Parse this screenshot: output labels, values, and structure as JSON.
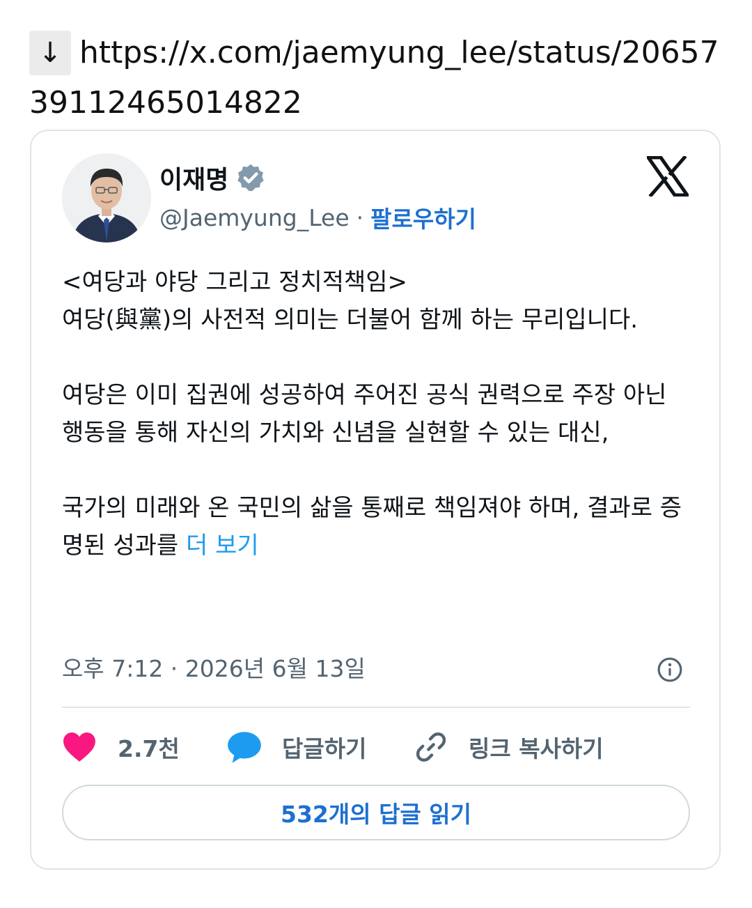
{
  "shared": {
    "arrow": "↓",
    "url": "https://x.com/jaemyung_lee/status/2065739112465014822"
  },
  "author": {
    "display_name": "이재명",
    "handle": "@Jaemyung_Lee",
    "separator": "·",
    "follow_label": "팔로우하기"
  },
  "tweet": {
    "lines": [
      "<여당과 야당 그리고 정치적책임>",
      "여당(與黨)의 사전적 의미는 더불어 함께 하는 무리입니다.",
      "",
      "여당은 이미 집권에 성공하여 주어진 공식 권력으로 주장 아닌 행동을 통해 자신의 가치와 신념을 실현할 수 있는 대신,",
      "",
      "국가의 미래와 온 국민의 삶을 통째로 책임져야 하며, 결과로 증명된 성과를 "
    ],
    "more_label": "더 보기",
    "timestamp": "오후 7:12 · 2026년 6월 13일"
  },
  "actions": {
    "likes": "2.7천",
    "reply_label": "답글하기",
    "copy_link_label": "링크 복사하기",
    "read_replies_label": "532개의 답글 읽기"
  },
  "icons": {
    "verified": "verified-badge-icon",
    "x_logo": "x-logo-icon",
    "info": "info-icon",
    "heart": "heart-icon",
    "reply": "speech-bubble-icon",
    "link": "link-icon"
  },
  "colors": {
    "accent": "#1d6fd0",
    "more_link": "#1d9bf0",
    "heart": "#f91880",
    "reply_bubble": "#1d9bf0",
    "secondary_text": "#536471",
    "border": "#e1e3e6"
  }
}
